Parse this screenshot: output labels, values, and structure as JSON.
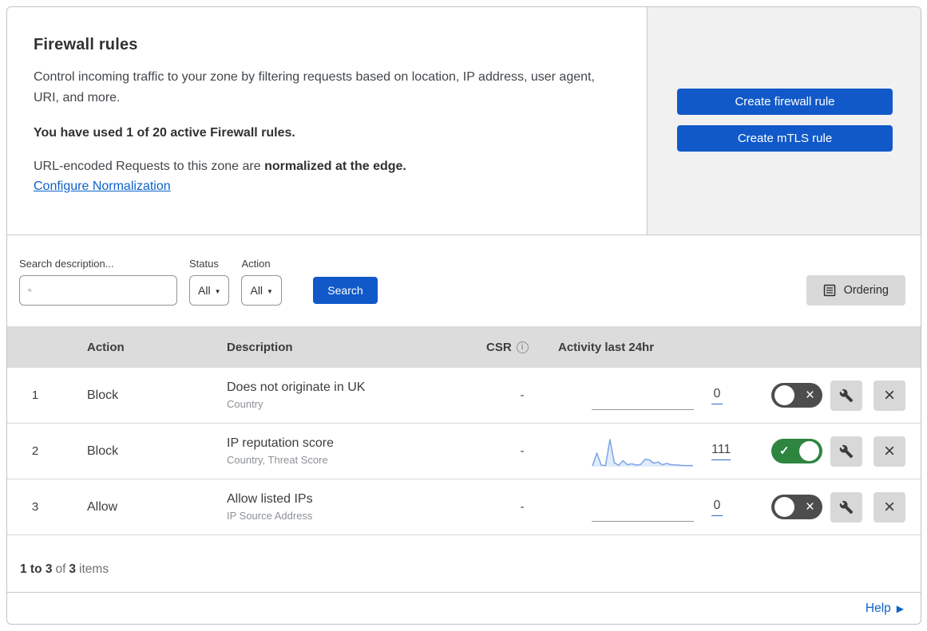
{
  "panel": {
    "title": "Firewall rules",
    "description": "Control incoming traffic to your zone by filtering requests based on location, IP address, user agent, URI, and more.",
    "usage_text": "You have used 1 of 20 active Firewall rules.",
    "normalization_prefix": "URL-encoded Requests to this zone are ",
    "normalization_bold": "normalized at the edge.",
    "normalization_link": "Configure Normalization",
    "create_firewall_button": "Create firewall rule",
    "create_mtls_button": "Create mTLS rule"
  },
  "filters": {
    "search_label": "Search description...",
    "status_label": "Status",
    "status_value": "All",
    "action_label": "Action",
    "action_value": "All",
    "search_button": "Search",
    "ordering_button": "Ordering"
  },
  "table": {
    "headers": {
      "action": "Action",
      "description": "Description",
      "csr": "CSR",
      "activity": "Activity last 24hr"
    },
    "rows": [
      {
        "priority": "1",
        "action": "Block",
        "description": "Does not originate in UK",
        "fields": "Country",
        "csr": "-",
        "activity_count": "0",
        "enabled": false,
        "sparkline": null
      },
      {
        "priority": "2",
        "action": "Block",
        "description": "IP reputation score",
        "fields": "Country, Threat Score",
        "csr": "-",
        "activity_count": "111",
        "enabled": true,
        "sparkline": [
          3,
          50,
          6,
          4,
          100,
          14,
          5,
          22,
          7,
          11,
          6,
          8,
          27,
          25,
          13,
          17,
          7,
          12,
          7,
          7,
          5,
          4,
          4,
          4
        ]
      },
      {
        "priority": "3",
        "action": "Allow",
        "description": "Allow listed IPs",
        "fields": "IP Source Address",
        "csr": "-",
        "activity_count": "0",
        "enabled": false,
        "sparkline": null
      }
    ]
  },
  "footer": {
    "range": "1 to 3",
    "of": "of",
    "total": "3",
    "items": "items",
    "help_link": "Help"
  },
  "colors": {
    "primary_blue": "#1159C9",
    "link_blue": "#0D62C9",
    "toggle_on_green": "#2E8540",
    "toggle_off_gray": "#4D4D4D",
    "sparkline_blue": "#7AA5E9",
    "panel_gray": "#F1F1F1",
    "header_gray": "#DCDCDC"
  }
}
